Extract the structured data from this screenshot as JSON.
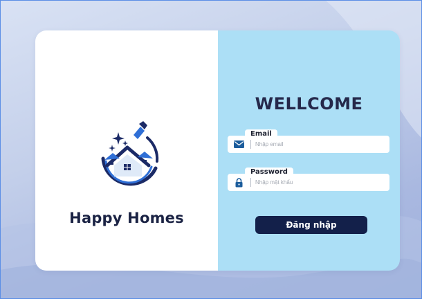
{
  "brand": {
    "name": "Happy Homes",
    "logo_icon": "house-cleaning-logo"
  },
  "login": {
    "title": "WELLCOME",
    "email": {
      "label": "Email",
      "placeholder": "Nhập email",
      "value": "",
      "icon": "envelope-icon"
    },
    "password": {
      "label": "Password",
      "placeholder": "Nhập mật khẩu",
      "value": "",
      "icon": "lock-icon"
    },
    "submit_label": "Đăng nhập"
  },
  "colors": {
    "left_panel": "#ffffff",
    "right_panel": "#acdff6",
    "button": "#13204a",
    "title": "#25284a",
    "icon": "#1c5d9c"
  }
}
